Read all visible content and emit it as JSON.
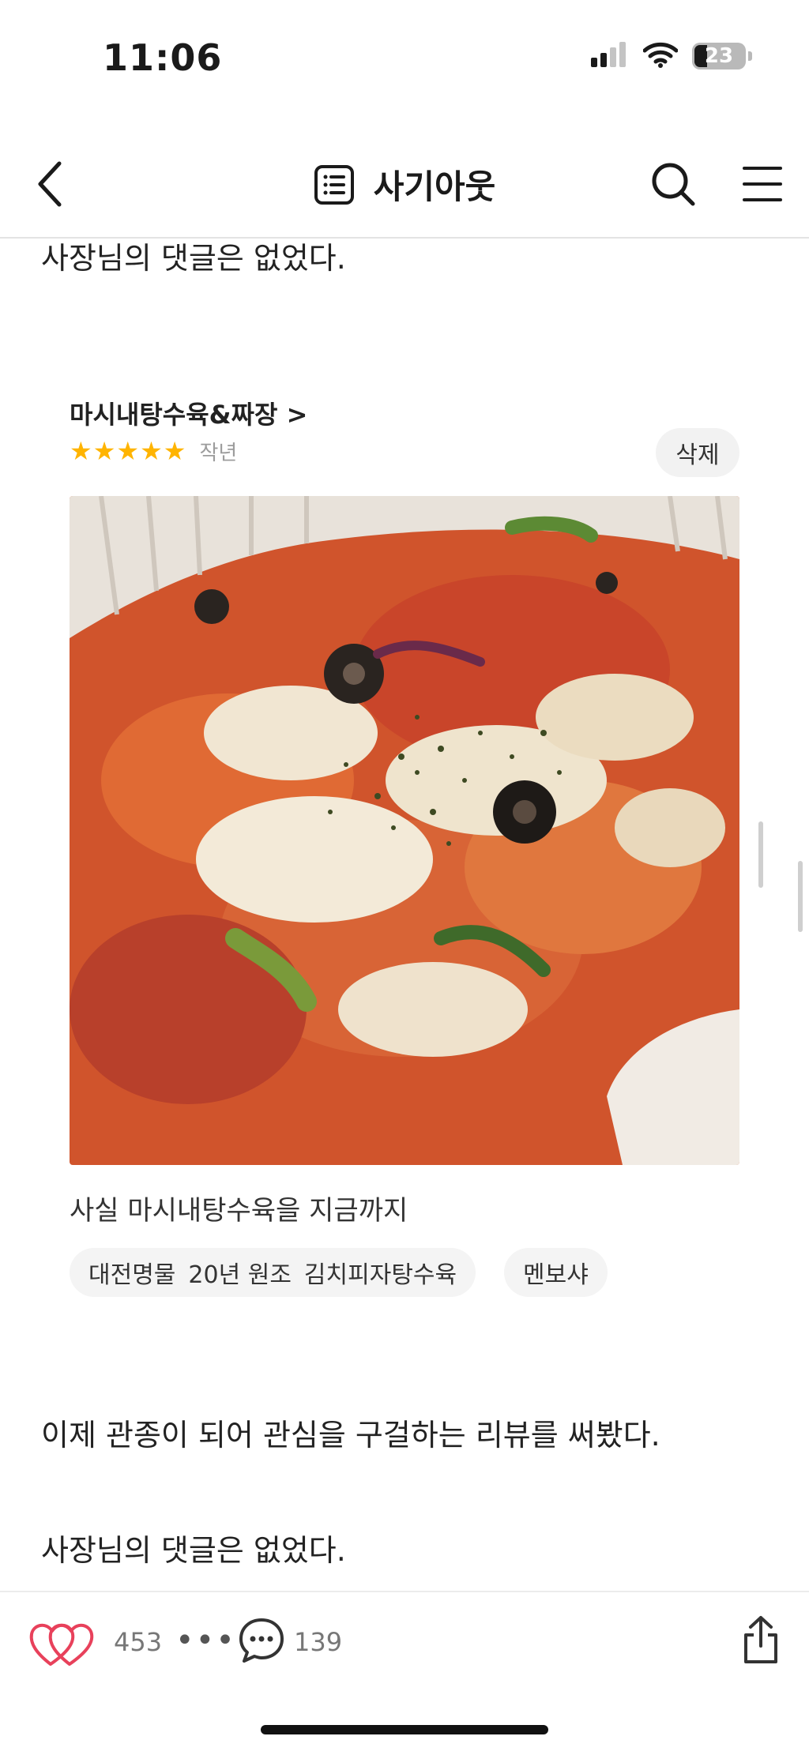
{
  "status_bar": {
    "time": "11:06",
    "battery": "23",
    "icons": [
      "cellular-signal-icon",
      "wifi-icon",
      "battery-icon"
    ]
  },
  "nav": {
    "title": "사기아웃",
    "icons": [
      "back-arrow-icon",
      "list-document-icon",
      "search-icon",
      "hamburger-menu-icon"
    ]
  },
  "post": {
    "line_top": "사장님의 댓글은 없었다.",
    "line_after_card": "이제 관종이 되어 관심을 구걸하는 리뷰를 써봤다.",
    "line_bottom": "사장님의 댓글은 없었다."
  },
  "review_card": {
    "store_name": "마시내탕수육&짜장",
    "chevron": ">",
    "stars": "★★★★★",
    "rating": 5,
    "date": "작년",
    "delete_label": "삭제",
    "photo_alt": "food-photo",
    "text": "사실 마시내탕수육을 지금까지",
    "tags": [
      [
        "대전명물",
        "20년 원조",
        "김치피자탕수육"
      ],
      [
        "멘보샤"
      ]
    ]
  },
  "bottom_bar": {
    "like_count": "453",
    "more": "•••",
    "comment_count": "139",
    "icons": [
      "heart-icon",
      "more-dots-icon",
      "comment-icon",
      "share-icon"
    ]
  },
  "colors": {
    "accent_heart": "#e8415b",
    "star": "#ffb400",
    "chip_bg": "#f4f4f4"
  }
}
